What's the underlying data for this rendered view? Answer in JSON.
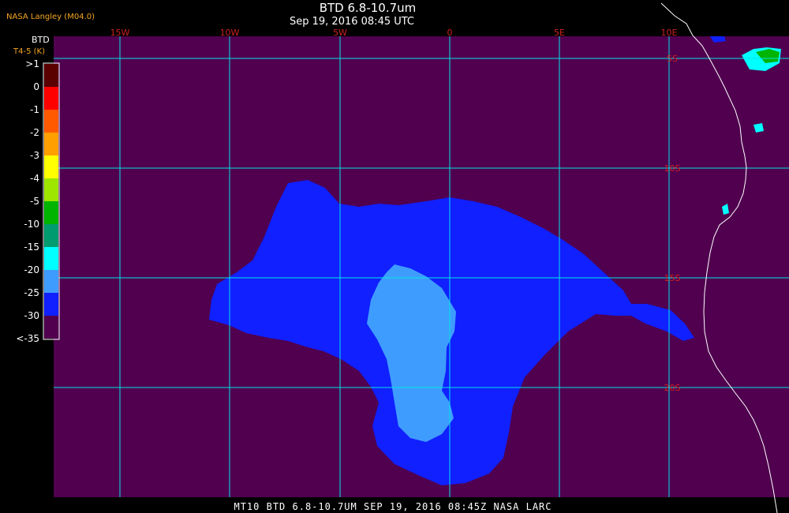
{
  "header": {
    "producer": "NASA Langley (M04.0)",
    "title": "BTD 6.8-10.7um",
    "datetime": "Sep 19, 2016 08:45 UTC"
  },
  "legend": {
    "title": "BTD",
    "subtitle": "T4-5 (K)",
    "labels": [
      ">1",
      "0",
      "-1",
      "-2",
      "-3",
      "-4",
      "-5",
      "-10",
      "-15",
      "-20",
      "-25",
      "-30",
      "<-35"
    ],
    "colors": [
      "#5a0000",
      "#ff0000",
      "#ff5a00",
      "#ff9f00",
      "#ffff00",
      "#9ee600",
      "#00b400",
      "#009b6e",
      "#00ffff",
      "#3f9cff",
      "#1020ff",
      "#50004f"
    ]
  },
  "map": {
    "lon_labels": [
      "15W",
      "10W",
      "5W",
      "0",
      "5E",
      "10E"
    ],
    "lat_labels": [
      "5S",
      "10S",
      "15S",
      "20S"
    ],
    "colors": {
      "background": "#50004f",
      "grid": "#00e5e5",
      "coast": "#ffffff",
      "grid_label": "#d02020",
      "cloud_dark": "#1020ff",
      "cloud_light": "#3f9cff",
      "cloud_cyan": "#00ffff",
      "cloud_green": "#00b400"
    }
  },
  "footer": {
    "text": "MT10  BTD 6.8-10.7UM   SEP 19, 2016 08:45Z   NASA LARC"
  }
}
